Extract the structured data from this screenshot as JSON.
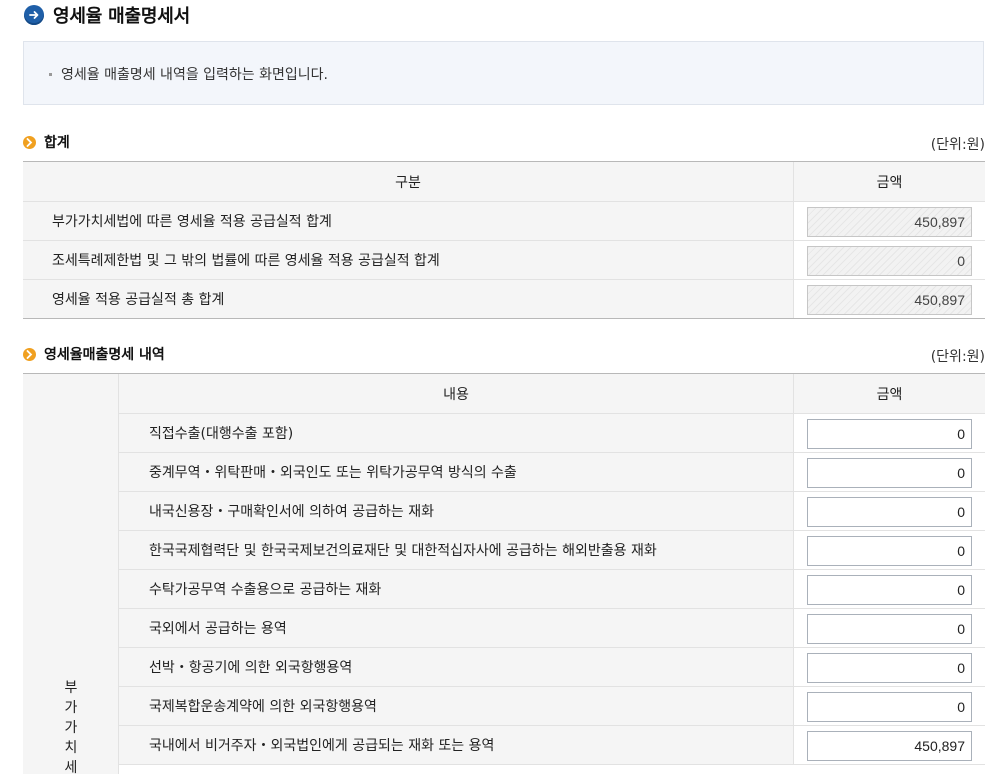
{
  "page": {
    "title": "영세율 매출명세서",
    "description": "영세율 매출명세 내역을 입력하는 화면입니다."
  },
  "summary": {
    "section_title": "합계",
    "unit": "(단위:원)",
    "headers": {
      "category": "구분",
      "amount": "금액"
    },
    "rows": [
      {
        "label": "부가가치세법에 따른 영세율 적용 공급실적 합계",
        "amount": "450,897"
      },
      {
        "label": "조세특례제한법 및 그 밖의 법률에 따른 영세율 적용 공급실적 합계",
        "amount": "0"
      },
      {
        "label": "영세율 적용 공급실적 총 합계",
        "amount": "450,897"
      }
    ]
  },
  "details": {
    "section_title": "영세율매출명세 내역",
    "unit": "(단위:원)",
    "headers": {
      "content": "내용",
      "amount": "금액"
    },
    "group_label": [
      "부",
      "가",
      "가",
      "치",
      "세"
    ],
    "rows": [
      {
        "label": "직접수출(대행수출 포함)",
        "amount": "0"
      },
      {
        "label": "중계무역・위탁판매・외국인도 또는 위탁가공무역 방식의 수출",
        "amount": "0"
      },
      {
        "label": "내국신용장・구매확인서에 의하여 공급하는 재화",
        "amount": "0"
      },
      {
        "label": "한국국제협력단 및 한국국제보건의료재단 및 대한적십자사에 공급하는 해외반출용 재화",
        "amount": "0"
      },
      {
        "label": "수탁가공무역 수출용으로 공급하는 재화",
        "amount": "0"
      },
      {
        "label": "국외에서 공급하는 용역",
        "amount": "0"
      },
      {
        "label": "선박・항공기에 의한 외국항행용역",
        "amount": "0"
      },
      {
        "label": "국제복합운송계약에 의한 외국항행용역",
        "amount": "0"
      },
      {
        "label": "국내에서 비거주자・외국법인에게 공급되는 재화 또는 용역",
        "amount": "450,897"
      }
    ]
  },
  "icons": {
    "title_icon": "arrow-right-circle-icon",
    "section_icon": "chevron-right-circle-icon"
  },
  "colors": {
    "title_icon": "#1f5fa8",
    "section_icon": "#f0a020",
    "info_box_bg": "#f3f6fb",
    "header_bg": "#f5f5f5"
  }
}
